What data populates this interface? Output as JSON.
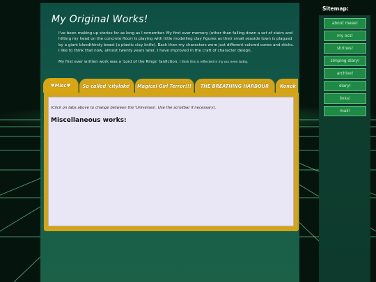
{
  "page": {
    "title": "My Original Works!",
    "intro_p1": "I've been making up stories for as long as I remember. My first ever memory (other than falling down a set of stairs and hitting my head on the concrete floor) is playing with little modelling clay figures as their small seaside town is plagued by a giant bloodthirsty beast (a plastic clay knife). Back then my characters were just different colored cones and sticks. I like to think that now, almost twenty years later, I have improved in the craft of character design.",
    "intro_p2": "My first ever written work was a 'Lord of the Rings' fanfiction.",
    "intro_p2_small": "I think this is reflected in my ocs even today."
  },
  "tabs": [
    {
      "label": "♥Misc♥",
      "active": true
    },
    {
      "label": "So called 'citylake'",
      "active": false
    },
    {
      "label": "Magical Girl Terror!!!",
      "active": false
    },
    {
      "label": "THE BREATHING HARBOUR",
      "active": false
    },
    {
      "label": "Konok",
      "active": false
    }
  ],
  "content": {
    "hint": "(Click on tabs above to change between the 'Universes'. Use the scrollbar if necessary).",
    "heading": "Miscellaneous works:"
  },
  "sitemap": {
    "title": "Sitemap:",
    "items": [
      "about meee!",
      "my ocs!",
      "shrines!",
      "simping diary!",
      "archive!",
      "diary!",
      "links!",
      "mail!"
    ]
  },
  "colors": {
    "panel": "#175f4b",
    "tab": "#d4a418",
    "content_bg": "#e9e7f6",
    "nav_button": "#1e8a45"
  }
}
